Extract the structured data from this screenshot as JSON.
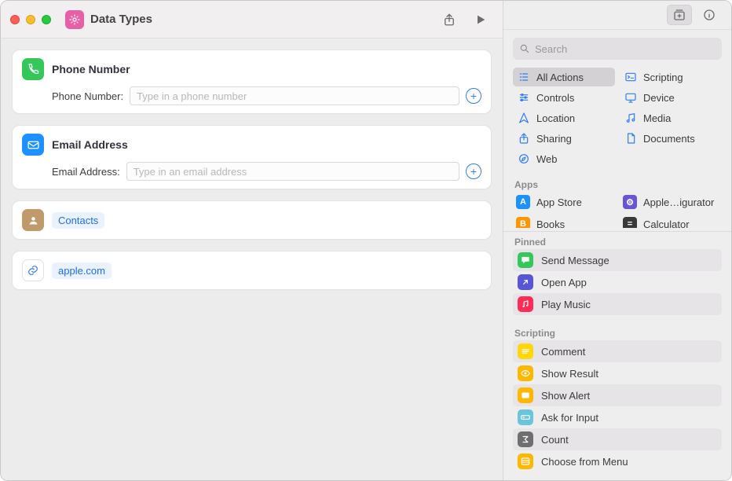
{
  "window": {
    "title": "Data Types"
  },
  "search": {
    "placeholder": "Search"
  },
  "categories": [
    {
      "id": "all",
      "label": "All Actions",
      "selected": true,
      "icon": "list",
      "color": "#2f7cf6"
    },
    {
      "id": "scripting",
      "label": "Scripting",
      "selected": false,
      "icon": "terminal",
      "color": "#2f7cf6"
    },
    {
      "id": "controls",
      "label": "Controls",
      "selected": false,
      "icon": "sliders",
      "color": "#2f7cf6"
    },
    {
      "id": "device",
      "label": "Device",
      "selected": false,
      "icon": "monitor",
      "color": "#2f7cf6"
    },
    {
      "id": "location",
      "label": "Location",
      "selected": false,
      "icon": "nav",
      "color": "#2f7cf6"
    },
    {
      "id": "media",
      "label": "Media",
      "selected": false,
      "icon": "music",
      "color": "#2f7cf6"
    },
    {
      "id": "sharing",
      "label": "Sharing",
      "selected": false,
      "icon": "share",
      "color": "#2f7cf6"
    },
    {
      "id": "documents",
      "label": "Documents",
      "selected": false,
      "icon": "document",
      "color": "#2f7cf6"
    },
    {
      "id": "web",
      "label": "Web",
      "selected": false,
      "icon": "compass",
      "color": "#2f7cf6"
    }
  ],
  "apps_header": "Apps",
  "apps": [
    {
      "label": "App Store",
      "color": "#1e90ff",
      "icon": "A"
    },
    {
      "label": "Apple…igurator",
      "color": "#6a54d6",
      "icon": "⚙"
    },
    {
      "label": "Books",
      "color": "#ff9500",
      "icon": "B"
    },
    {
      "label": "Calculator",
      "color": "#3a3a3a",
      "icon": "="
    }
  ],
  "pinned_header": "Pinned",
  "pinned": [
    {
      "label": "Send Message",
      "color": "#34c759",
      "icon": "msg"
    },
    {
      "label": "Open App",
      "color": "#5856d6",
      "icon": "open"
    },
    {
      "label": "Play Music",
      "color": "#ff2d55",
      "icon": "music"
    }
  ],
  "scripting_header": "Scripting",
  "scripting": [
    {
      "label": "Comment",
      "color": "#ffd60a",
      "icon": "lines"
    },
    {
      "label": "Show Result",
      "color": "#ffb800",
      "icon": "eye"
    },
    {
      "label": "Show Alert",
      "color": "#ffb800",
      "icon": "alert"
    },
    {
      "label": "Ask for Input",
      "color": "#6ac4dc",
      "icon": "input"
    },
    {
      "label": "Count",
      "color": "#6f6f6f",
      "icon": "sigma"
    },
    {
      "label": "Choose from Menu",
      "color": "#ffb800",
      "icon": "menu"
    }
  ],
  "actions": {
    "phone": {
      "title": "Phone Number",
      "param_label": "Phone Number:",
      "placeholder": "Type in a phone number",
      "value": ""
    },
    "email": {
      "title": "Email Address",
      "param_label": "Email Address:",
      "placeholder": "Type in an email address",
      "value": ""
    },
    "contacts": {
      "chip": "Contacts"
    },
    "url": {
      "chip": "apple.com"
    }
  }
}
